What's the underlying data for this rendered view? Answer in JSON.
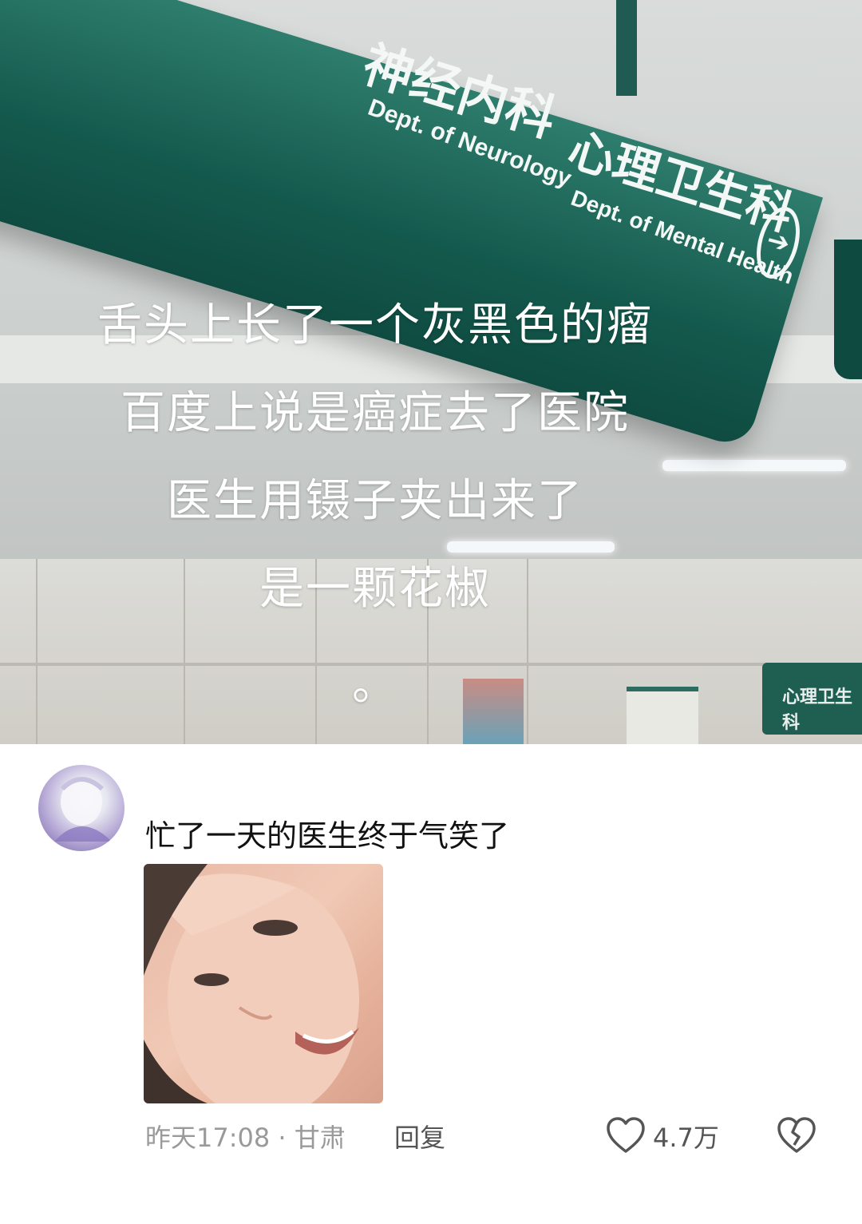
{
  "photo": {
    "sign": {
      "dept1_cn": "神经内科",
      "dept1_en": "Dept. of Neurology",
      "dept2_cn": "心理卫生科",
      "dept2_en": "Dept. of Mental Health",
      "background_sign": "心理卫生科"
    },
    "caption_lines": [
      "舌头上长了一个灰黑色的瘤",
      "百度上说是癌症去了医院",
      "医生用镊子夹出来了",
      "是一颗花椒",
      "。"
    ]
  },
  "comment": {
    "text": "忙了一天的医生终于气笑了",
    "meta": "昨天17:08 · 甘肃",
    "reply_label": "回复",
    "like_count": "4.7万",
    "icons": {
      "like": "heart-outline-icon",
      "dislike": "broken-heart-icon"
    },
    "colors": {
      "meta": "#9a9a9a",
      "action": "#555555",
      "text": "#111111"
    }
  }
}
